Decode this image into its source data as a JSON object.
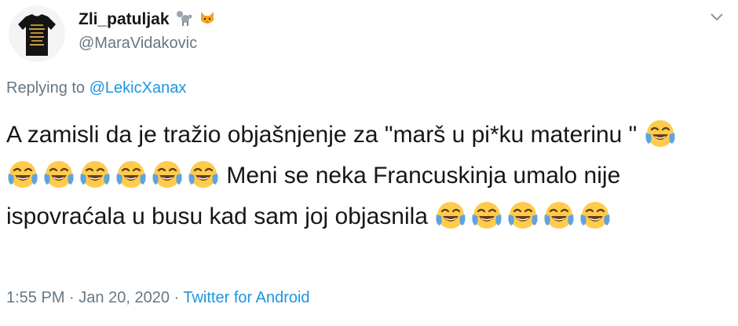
{
  "user": {
    "display_name": "Zli_patuljak",
    "name_emojis": [
      "poodle-icon",
      "cat-face-icon"
    ],
    "handle": "@MaraVidakovic"
  },
  "reply": {
    "prefix": "Replying to",
    "to_handle": "@LekicXanax"
  },
  "tweet": {
    "text_1": "A zamisli da je tražio objašnjenje za \"marš u pi*ku materinu \"",
    "emoji_group_1_count": 7,
    "text_2": "Meni se neka Francuskinja umalo nije ispovraćala u busu kad sam joj objasnila",
    "emoji_group_2_count": 5,
    "emoji_name": "face-with-tears-of-joy-icon"
  },
  "meta": {
    "time": "1:55 PM",
    "separator_1": "·",
    "date": "Jan 20, 2020",
    "separator_2": "·",
    "source": "Twitter for Android"
  },
  "colors": {
    "text": "#14171a",
    "secondary": "#657786",
    "link": "#1b95e0",
    "emoji_face": "#ffcb4c",
    "emoji_tears": "#5ea3e0"
  }
}
